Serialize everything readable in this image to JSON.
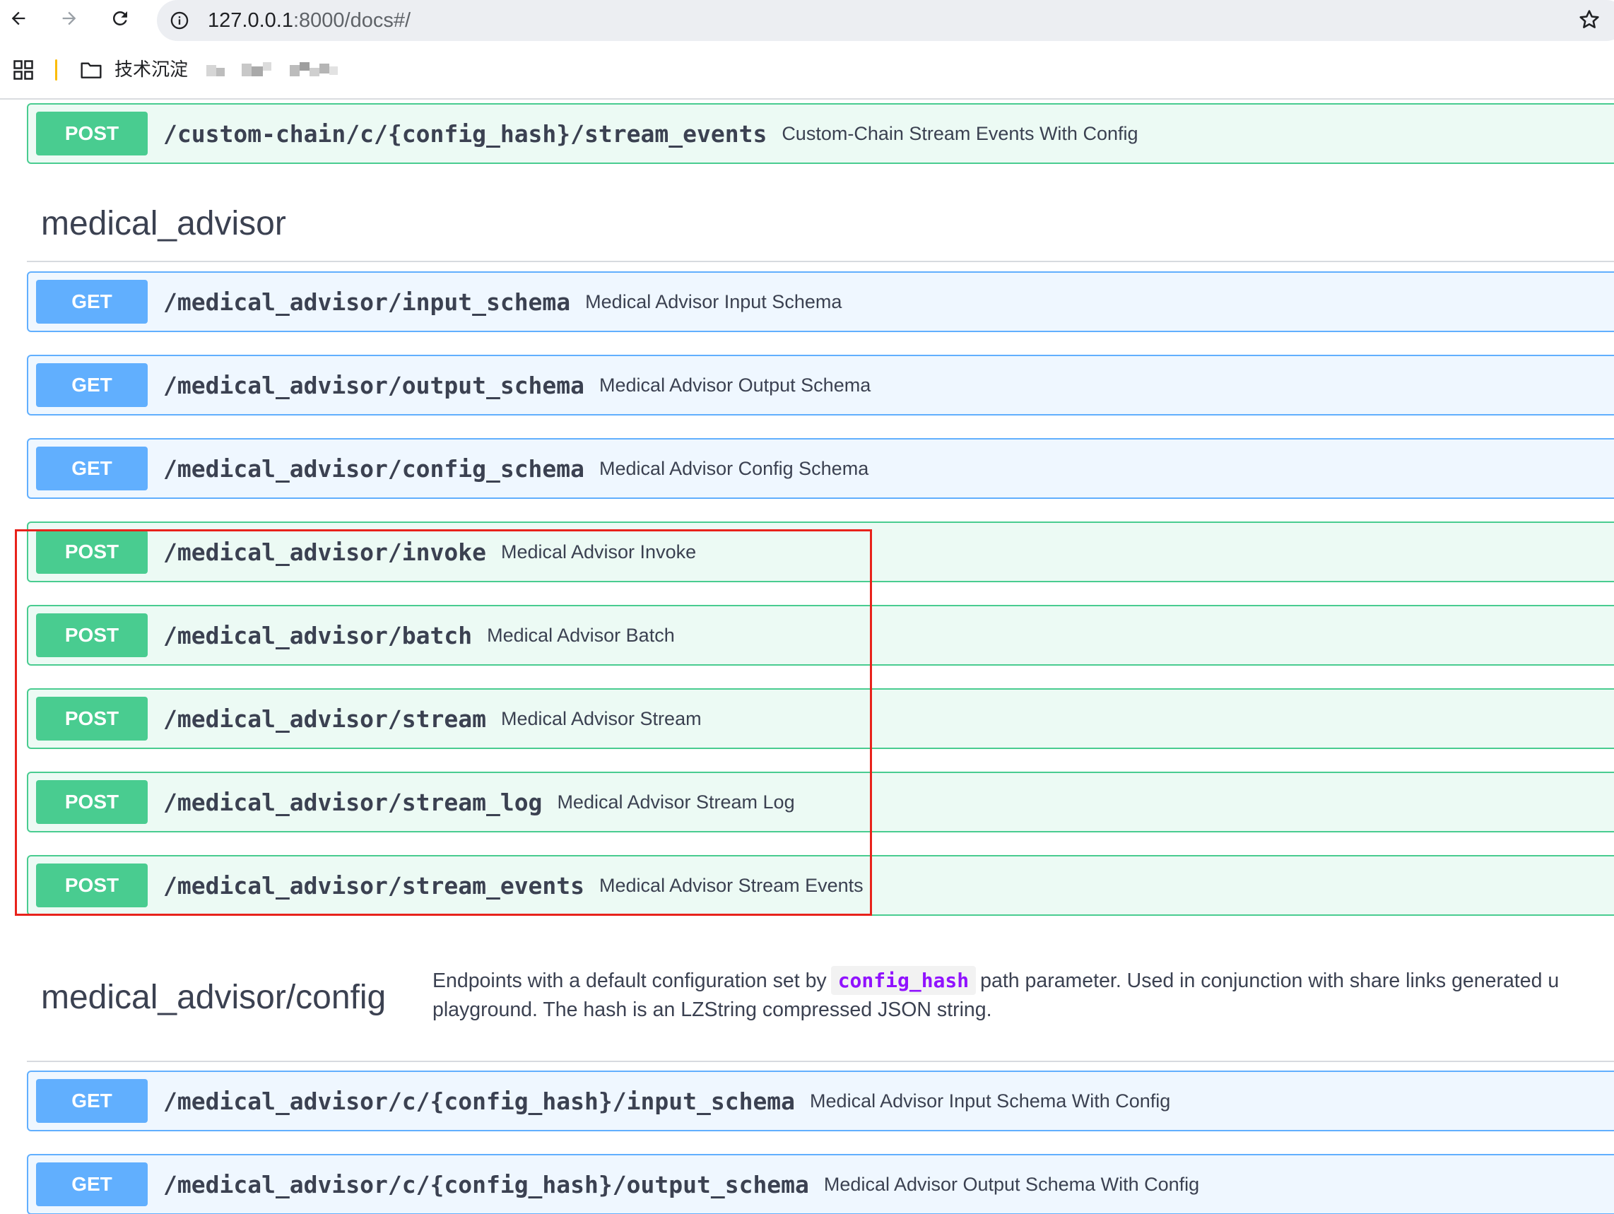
{
  "browser": {
    "url_host": "127.0.0.1",
    "url_rest": ":8000/docs#/",
    "bookmarks": [
      {
        "label": "技术沉淀"
      }
    ]
  },
  "top_operation": {
    "method": "POST",
    "path": "/custom-chain/c/{config_hash}/stream_events",
    "summary": "Custom-Chain Stream Events With Config"
  },
  "sections": [
    {
      "title": "medical_advisor",
      "operations": [
        {
          "method": "GET",
          "path": "/medical_advisor/input_schema",
          "summary": "Medical Advisor Input Schema"
        },
        {
          "method": "GET",
          "path": "/medical_advisor/output_schema",
          "summary": "Medical Advisor Output Schema"
        },
        {
          "method": "GET",
          "path": "/medical_advisor/config_schema",
          "summary": "Medical Advisor Config Schema"
        },
        {
          "method": "POST",
          "path": "/medical_advisor/invoke",
          "summary": "Medical Advisor Invoke"
        },
        {
          "method": "POST",
          "path": "/medical_advisor/batch",
          "summary": "Medical Advisor Batch"
        },
        {
          "method": "POST",
          "path": "/medical_advisor/stream",
          "summary": "Medical Advisor Stream"
        },
        {
          "method": "POST",
          "path": "/medical_advisor/stream_log",
          "summary": "Medical Advisor Stream Log"
        },
        {
          "method": "POST",
          "path": "/medical_advisor/stream_events",
          "summary": "Medical Advisor Stream Events"
        }
      ]
    },
    {
      "title": "medical_advisor/config",
      "description_before": "Endpoints with a default configuration set by",
      "description_code": "config_hash",
      "description_after": "path parameter. Used in conjunction with share links generated u",
      "description_line2": "playground. The hash is an LZString compressed JSON string.",
      "operations": [
        {
          "method": "GET",
          "path": "/medical_advisor/c/{config_hash}/input_schema",
          "summary": "Medical Advisor Input Schema With Config"
        },
        {
          "method": "GET",
          "path": "/medical_advisor/c/{config_hash}/output_schema",
          "summary": "Medical Advisor Output Schema With Config"
        }
      ]
    }
  ],
  "colors": {
    "post": "#49cc90",
    "get": "#61affe",
    "highlight": "#e8221b",
    "code": "#9012fe"
  },
  "icons": [
    "back-arrow-icon",
    "forward-arrow-icon",
    "reload-icon",
    "info-icon",
    "star-icon",
    "apps-grid-icon",
    "folder-icon"
  ]
}
